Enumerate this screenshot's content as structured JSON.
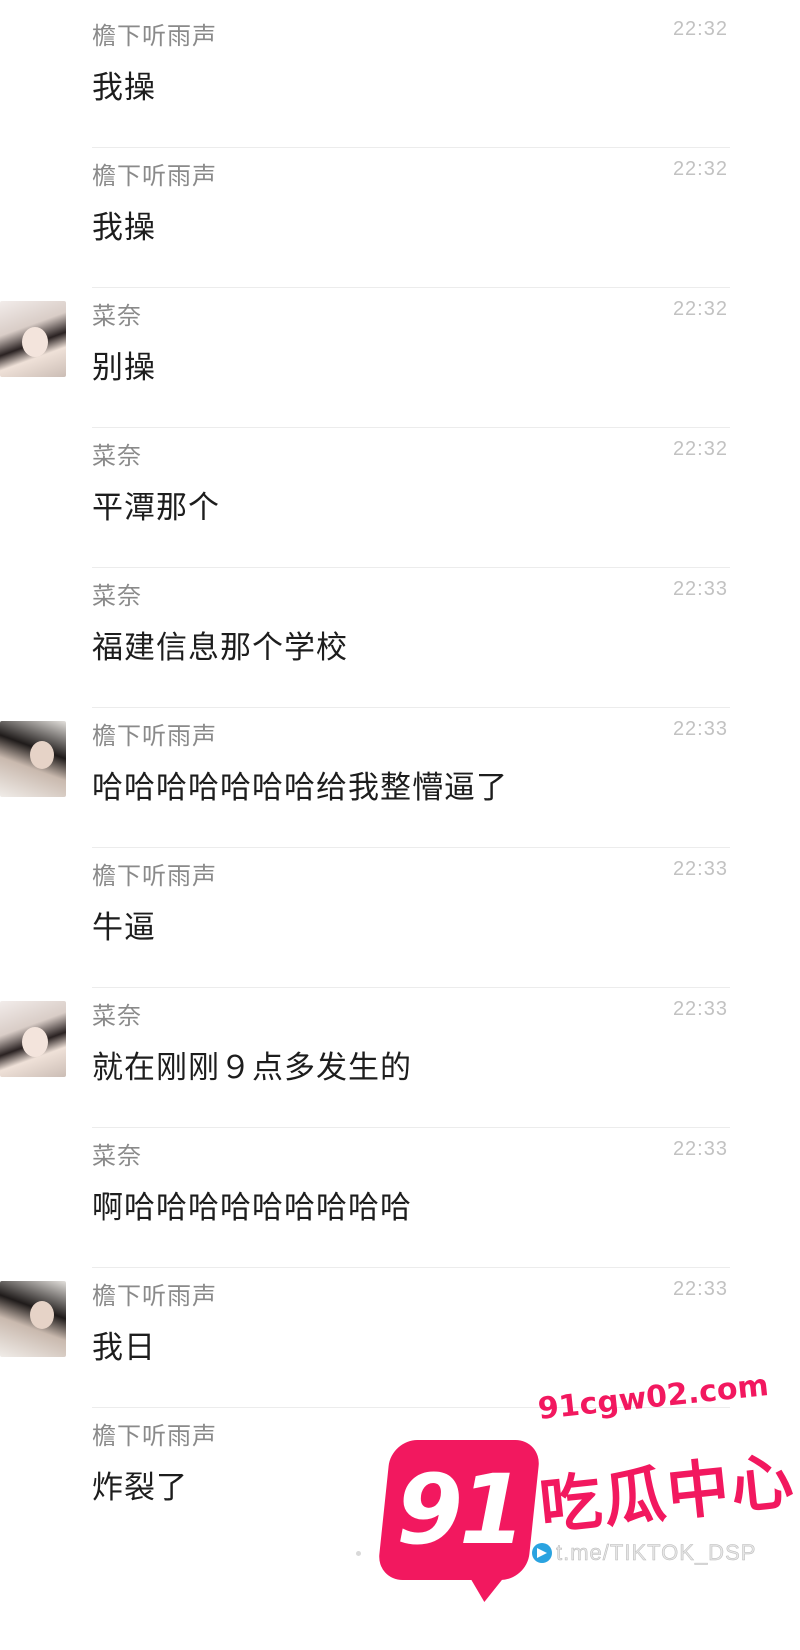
{
  "messages": [
    {
      "sender": "檐下听雨声",
      "time": "22:32",
      "text": "我操",
      "avatar": ""
    },
    {
      "sender": "檐下听雨声",
      "time": "22:32",
      "text": "我操",
      "avatar": ""
    },
    {
      "sender": "菜奈",
      "time": "22:32",
      "text": "别操",
      "avatar": "a1"
    },
    {
      "sender": "菜奈",
      "time": "22:32",
      "text": "平潭那个",
      "avatar": ""
    },
    {
      "sender": "菜奈",
      "time": "22:33",
      "text": "福建信息那个学校",
      "avatar": ""
    },
    {
      "sender": "檐下听雨声",
      "time": "22:33",
      "text": "哈哈哈哈哈哈哈给我整懵逼了",
      "avatar": "a2"
    },
    {
      "sender": "檐下听雨声",
      "time": "22:33",
      "text": "牛逼",
      "avatar": ""
    },
    {
      "sender": "菜奈",
      "time": "22:33",
      "text": "就在刚刚９点多发生的",
      "avatar": "a1"
    },
    {
      "sender": "菜奈",
      "time": "22:33",
      "text": "啊哈哈哈哈哈哈哈哈哈",
      "avatar": ""
    },
    {
      "sender": "檐下听雨声",
      "time": "22:33",
      "text": "我日",
      "avatar": "a2"
    },
    {
      "sender": "檐下听雨声",
      "time": "",
      "text": "炸裂了",
      "avatar": ""
    }
  ],
  "watermark": {
    "number": "91",
    "domain": "91cgw02.com",
    "name": "吃瓜中心",
    "channel": "t.me/TIKTOK_DSP",
    "brand_color": "#f2185f"
  }
}
